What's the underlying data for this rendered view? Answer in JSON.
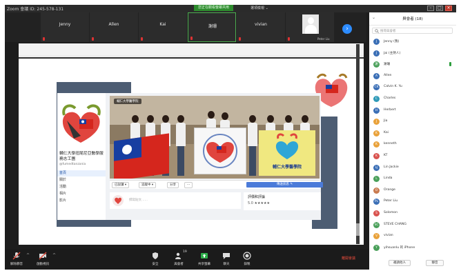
{
  "titlebar": {
    "title": "Zoom 會議 ID: 245-578-131",
    "share_banner": "您正在觀看螢幕共用",
    "view_options": "選項檢視 ⌄"
  },
  "gallery": {
    "participants": [
      {
        "name": "Jenny"
      },
      {
        "name": "Allen"
      },
      {
        "name": "Kai"
      },
      {
        "name": "謝珊"
      },
      {
        "name": "vivian"
      },
      {
        "name": "Peter Liu"
      }
    ]
  },
  "share": {
    "cover_tag": "輔仁大學醫學院",
    "page_name": "輔仁大學扭尾尼亞醫學服務志工團",
    "page_id": "@fumedtanzania",
    "nav": [
      "首頁",
      "關於",
      "活動",
      "相片",
      "影片"
    ],
    "banner_text": "輔仁大學醫學院",
    "actions": [
      "已說讚 ▾",
      "追蹤中 ▾",
      "分享",
      "···"
    ],
    "message_button": "傳送訊息 ✎",
    "composer_placeholder": "撰寫貼文……",
    "review_title": "評價和評論",
    "review_score": "5.0 ★★★★★"
  },
  "sidebar": {
    "title": "與會者 (18)",
    "search_placeholder": "搜尋與會者",
    "participants": [
      {
        "initial": "J",
        "name": "Jenny (我)",
        "color": "#3b6fb6",
        "mic": false
      },
      {
        "initial": "J",
        "name": "Jai (主持人)",
        "color": "#3b6fb6",
        "mic": false
      },
      {
        "initial": "謝",
        "name": "謝珊",
        "color": "#4aa05a",
        "mic": true
      },
      {
        "initial": "A",
        "name": "Allen",
        "color": "#3b6fb6",
        "mic": false
      },
      {
        "initial": "CK",
        "name": "Calvin K. Yu",
        "color": "#3b6fb6",
        "mic": false
      },
      {
        "initial": "C",
        "name": "Charles",
        "color": "#2f9ab8",
        "mic": false
      },
      {
        "initial": "H",
        "name": "Herbert",
        "color": "#3b6fb6",
        "mic": false
      },
      {
        "initial": "J",
        "name": "Jia",
        "color": "#e9a23b",
        "mic": false
      },
      {
        "initial": "K",
        "name": "Kai",
        "color": "#e9a23b",
        "mic": false
      },
      {
        "initial": "K",
        "name": "kenneth",
        "color": "#e9a23b",
        "mic": false
      },
      {
        "initial": "K",
        "name": "KT",
        "color": "#d9534f",
        "mic": false
      },
      {
        "initial": "LJ",
        "name": "Lin Jackie",
        "color": "#3b6fb6",
        "mic": false
      },
      {
        "initial": "L",
        "name": "Linda",
        "color": "#4aa05a",
        "mic": false
      },
      {
        "initial": "O",
        "name": "Orange",
        "color": "#c97b50",
        "mic": false
      },
      {
        "initial": "PL",
        "name": "Peter Liu",
        "color": "#3b6fb6",
        "mic": false
      },
      {
        "initial": "S",
        "name": "Solomon",
        "color": "#d9534f",
        "mic": false
      },
      {
        "initial": "SC",
        "name": "STEVE CHANG",
        "color": "#4aa05a",
        "mic": false
      },
      {
        "initial": "V",
        "name": "vivian",
        "color": "#e9a23b",
        "mic": false
      },
      {
        "initial": "Y",
        "name": "yihsuanlu 的 iPhone",
        "color": "#4aa05a",
        "mic": false
      }
    ],
    "invite_button": "邀請他人",
    "mute_all_button": "靜音"
  },
  "toolbar": {
    "mute_label": "解除靜音",
    "video_label": "啟動視訊",
    "security_label": "安全",
    "participants_label": "與會者",
    "participants_count": "19",
    "share_label": "共享螢幕",
    "chat_label": "聊天",
    "record_label": "錄製",
    "leave_label": "離開會議"
  }
}
